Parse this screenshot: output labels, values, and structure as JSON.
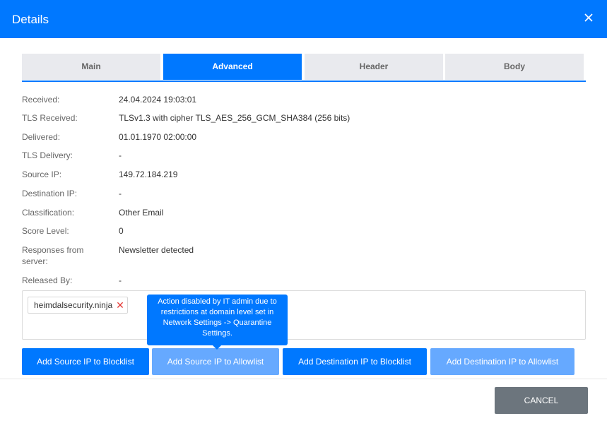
{
  "dialog": {
    "title": "Details",
    "close_icon": "close-icon"
  },
  "tabs": [
    {
      "label": "Main",
      "active": false
    },
    {
      "label": "Advanced",
      "active": true
    },
    {
      "label": "Header",
      "active": false
    },
    {
      "label": "Body",
      "active": false
    }
  ],
  "fields": [
    {
      "label": "Received:",
      "value": "24.04.2024 19:03:01"
    },
    {
      "label": "TLS Received:",
      "value": "TLSv1.3 with cipher TLS_AES_256_GCM_SHA384 (256 bits)"
    },
    {
      "label": "Delivered:",
      "value": "01.01.1970 02:00:00"
    },
    {
      "label": "TLS Delivery:",
      "value": "-"
    },
    {
      "label": "Source IP:",
      "value": "149.72.184.219"
    },
    {
      "label": "Destination IP:",
      "value": "-"
    },
    {
      "label": "Classification:",
      "value": "Other Email"
    },
    {
      "label": "Score Level:",
      "value": "0"
    },
    {
      "label": "Responses from server:",
      "value": "Newsletter detected"
    },
    {
      "label": "Released By:",
      "value": "-"
    }
  ],
  "tag": {
    "text": "heimdalsecurity.ninja",
    "remove": "✕"
  },
  "tooltip": {
    "text": "Action disabled by IT admin due to restrictions at domain level set in Network Settings -> Quarantine Settings."
  },
  "actions": [
    {
      "label": "Add Source IP to Blocklist",
      "enabled": true
    },
    {
      "label": "Add Source IP to Allowlist",
      "enabled": false
    },
    {
      "label": "Add Destination IP to Blocklist",
      "enabled": true
    },
    {
      "label": "Add Destination IP to Allowlist",
      "enabled": false
    }
  ],
  "footer": {
    "cancel_label": "CANCEL"
  },
  "colors": {
    "primary": "#0078ff",
    "disabled": "#66a9ff",
    "cancel": "#6c757d",
    "remove_x": "#e53935"
  }
}
